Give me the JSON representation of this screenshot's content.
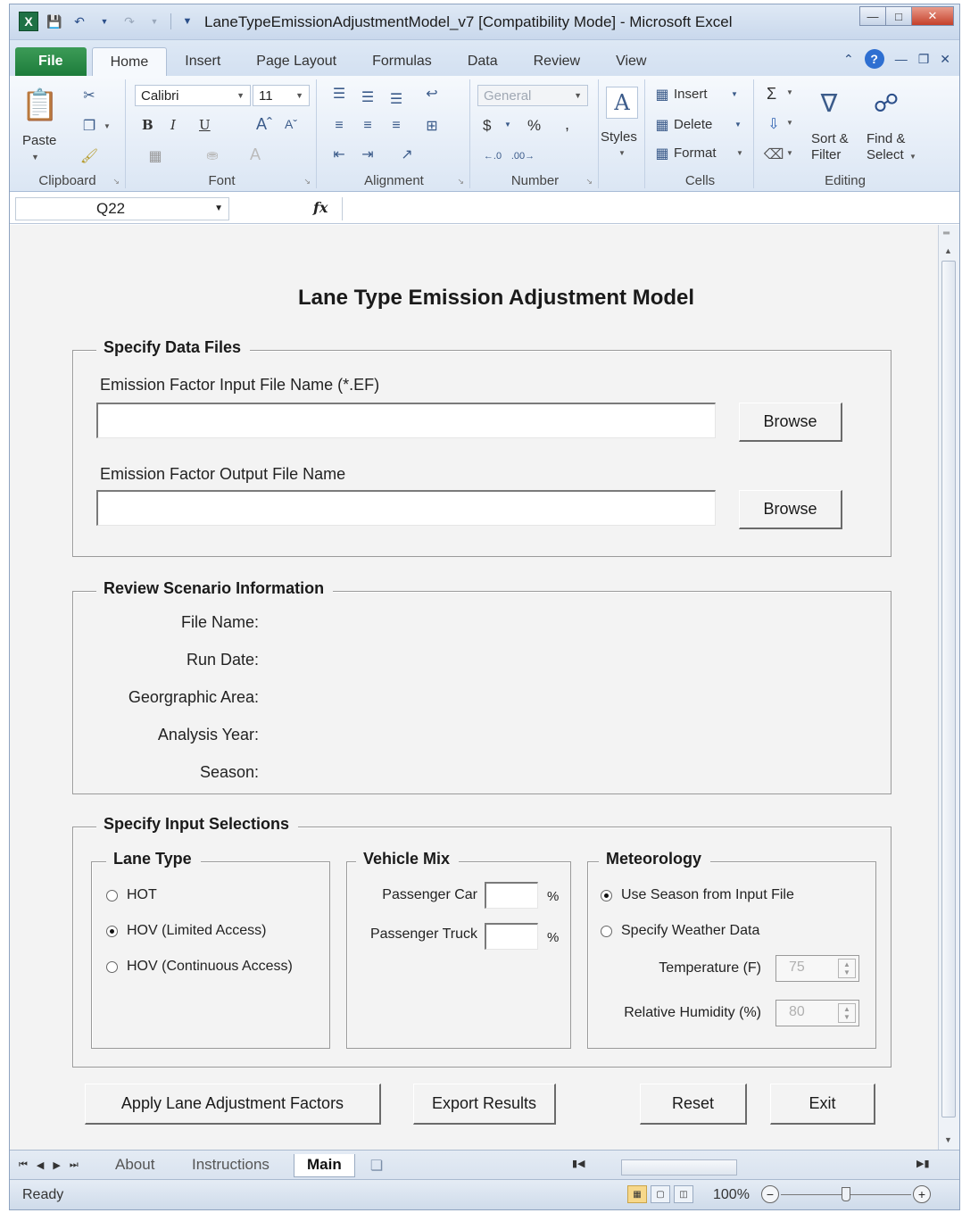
{
  "window": {
    "title": "LaneTypeEmissionAdjustmentModel_v7  [Compatibility Mode]  -  Microsoft Excel",
    "app_icon": "X"
  },
  "ribbon": {
    "tabs": [
      {
        "label": "File"
      },
      {
        "label": "Home"
      },
      {
        "label": "Insert"
      },
      {
        "label": "Page Layout"
      },
      {
        "label": "Formulas"
      },
      {
        "label": "Data"
      },
      {
        "label": "Review"
      },
      {
        "label": "View"
      }
    ],
    "clipboard": {
      "paste": "Paste",
      "label": "Clipboard"
    },
    "font": {
      "name": "Calibri",
      "size": "11",
      "label": "Font",
      "bold": "B",
      "italic": "I",
      "underline": "U"
    },
    "alignment": {
      "label": "Alignment"
    },
    "number": {
      "format": "General",
      "currency": "$",
      "percent": "%",
      "comma": ",",
      "label": "Number"
    },
    "styles": {
      "label": "Styles"
    },
    "cells": {
      "insert": "Insert",
      "delete": "Delete",
      "format": "Format",
      "label": "Cells"
    },
    "editing": {
      "sum": "Σ",
      "sort": "Sort &",
      "filter": "Filter",
      "find": "Find &",
      "select": "Select",
      "label": "Editing"
    }
  },
  "formula_bar": {
    "name_box": "Q22",
    "fx": "fx",
    "value": ""
  },
  "form": {
    "title": "Lane Type Emission Adjustment Model",
    "data_files": {
      "legend": "Specify Data Files",
      "input_label": "Emission Factor Input File Name (*.EF)",
      "input_value": "",
      "output_label": "Emission Factor Output File Name",
      "output_value": "",
      "browse_label": "Browse"
    },
    "scenario": {
      "legend": "Review Scenario Information",
      "file_name": "File Name:",
      "run_date": "Run Date:",
      "area": "Georgraphic Area:",
      "year": "Analysis Year:",
      "season": "Season:"
    },
    "inputs": {
      "legend": "Specify Input Selections",
      "lane_type": {
        "legend": "Lane Type",
        "options": [
          "HOT",
          "HOV (Limited Access)",
          "HOV (Continuous Access)"
        ],
        "selected": "HOV (Limited Access)"
      },
      "vehicle_mix": {
        "legend": "Vehicle Mix",
        "car_label": "Passenger Car",
        "truck_label": "Passenger Truck",
        "unit": "%",
        "car_value": "",
        "truck_value": ""
      },
      "meteorology": {
        "legend": "Meteorology",
        "opt_season": "Use Season from Input File",
        "opt_weather": "Specify Weather Data",
        "selected": "Use Season from Input File",
        "temp_label": "Temperature (F)",
        "temp_value": "75",
        "humidity_label": "Relative Humidity (%)",
        "humidity_value": "80"
      }
    },
    "buttons": {
      "apply": "Apply Lane Adjustment Factors",
      "export": "Export Results",
      "reset": "Reset",
      "exit": "Exit"
    }
  },
  "sheet_tabs": [
    {
      "label": "About"
    },
    {
      "label": "Instructions"
    },
    {
      "label": "Main"
    }
  ],
  "active_sheet": "Main",
  "status": {
    "ready": "Ready",
    "zoom": "100%"
  },
  "colors": {
    "file_tab": "#1d7c3b",
    "ribbon": "#dbe6f4",
    "form_bg": "#f3f3f3"
  }
}
